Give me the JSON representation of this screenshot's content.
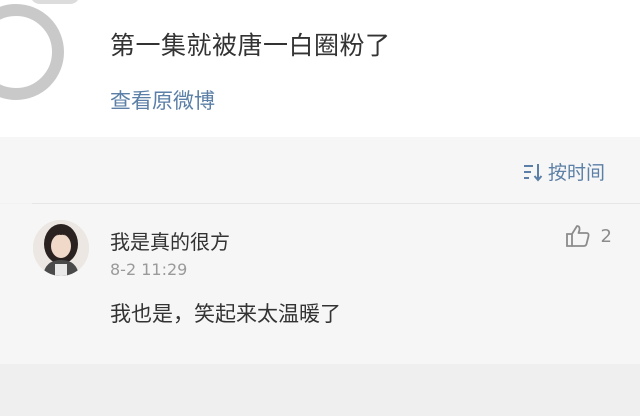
{
  "post": {
    "text": "第一集就被唐一白圈粉了",
    "view_original": "查看原微博"
  },
  "sort": {
    "label": "按时间",
    "icon": "sort-icon"
  },
  "comment": {
    "username": "我是真的很方",
    "timestamp": "8-2 11:29",
    "text": "我也是，笑起来太温暖了",
    "like_count": "2",
    "like_icon": "thumbs-up-icon"
  },
  "colors": {
    "link": "#5b7fa6",
    "text": "#333333",
    "muted": "#9a9a9a"
  }
}
